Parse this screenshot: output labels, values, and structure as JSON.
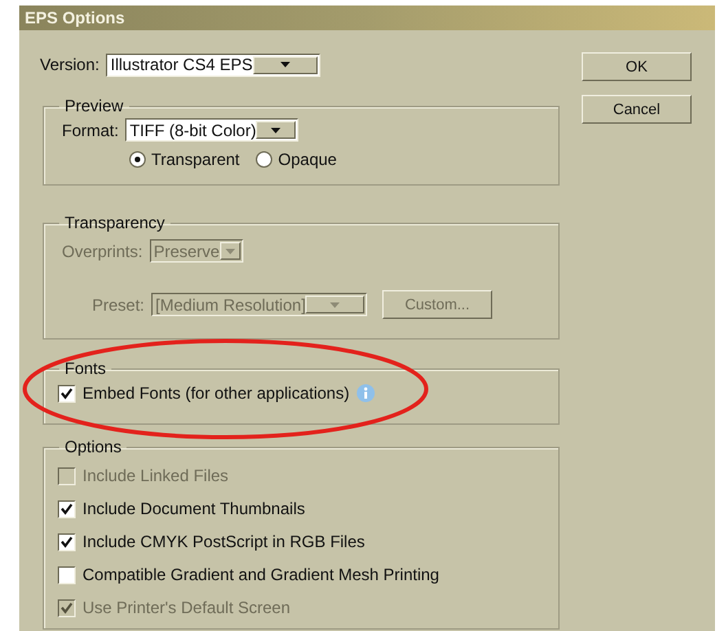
{
  "window": {
    "title": "EPS Options"
  },
  "version": {
    "label": "Version:",
    "value": "Illustrator CS4 EPS"
  },
  "buttons": [
    {
      "label": "OK"
    },
    {
      "label": "Cancel"
    }
  ],
  "preview": {
    "title": "Preview",
    "format": {
      "label": "Format:",
      "value": "TIFF (8-bit Color)"
    },
    "background": [
      {
        "label": "Transparent",
        "selected": true
      },
      {
        "label": "Opaque",
        "selected": false
      }
    ]
  },
  "transparency": {
    "title": "Transparency",
    "disabled": true,
    "overprints": {
      "label": "Overprints:",
      "value": "Preserve"
    },
    "preset": {
      "label": "Preset:",
      "value": "[Medium Resolution]"
    },
    "custom_button": "Custom..."
  },
  "fonts": {
    "title": "Fonts",
    "highlighted": true,
    "embed": {
      "label": "Embed Fonts (for other applications)",
      "checked": true
    }
  },
  "options": {
    "title": "Options",
    "items": [
      {
        "label": "Include Linked Files",
        "checked": false,
        "disabled": true
      },
      {
        "label": "Include Document Thumbnails",
        "checked": true,
        "disabled": false
      },
      {
        "label": "Include CMYK PostScript in RGB Files",
        "checked": true,
        "disabled": false
      },
      {
        "label": "Compatible Gradient and Gradient Mesh Printing",
        "checked": false,
        "disabled": false
      },
      {
        "label": "Use Printer's Default Screen",
        "checked": true,
        "disabled": true
      }
    ]
  }
}
